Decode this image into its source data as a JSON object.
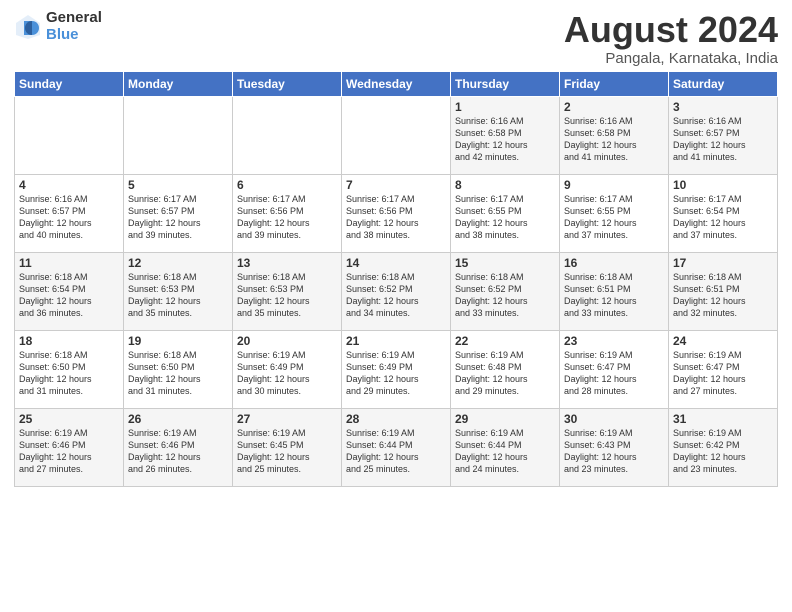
{
  "logo": {
    "general": "General",
    "blue": "Blue"
  },
  "title": {
    "month_year": "August 2024",
    "location": "Pangala, Karnataka, India"
  },
  "weekdays": [
    "Sunday",
    "Monday",
    "Tuesday",
    "Wednesday",
    "Thursday",
    "Friday",
    "Saturday"
  ],
  "weeks": [
    [
      {
        "day": "",
        "info": ""
      },
      {
        "day": "",
        "info": ""
      },
      {
        "day": "",
        "info": ""
      },
      {
        "day": "",
        "info": ""
      },
      {
        "day": "1",
        "info": "Sunrise: 6:16 AM\nSunset: 6:58 PM\nDaylight: 12 hours\nand 42 minutes."
      },
      {
        "day": "2",
        "info": "Sunrise: 6:16 AM\nSunset: 6:58 PM\nDaylight: 12 hours\nand 41 minutes."
      },
      {
        "day": "3",
        "info": "Sunrise: 6:16 AM\nSunset: 6:57 PM\nDaylight: 12 hours\nand 41 minutes."
      }
    ],
    [
      {
        "day": "4",
        "info": "Sunrise: 6:16 AM\nSunset: 6:57 PM\nDaylight: 12 hours\nand 40 minutes."
      },
      {
        "day": "5",
        "info": "Sunrise: 6:17 AM\nSunset: 6:57 PM\nDaylight: 12 hours\nand 39 minutes."
      },
      {
        "day": "6",
        "info": "Sunrise: 6:17 AM\nSunset: 6:56 PM\nDaylight: 12 hours\nand 39 minutes."
      },
      {
        "day": "7",
        "info": "Sunrise: 6:17 AM\nSunset: 6:56 PM\nDaylight: 12 hours\nand 38 minutes."
      },
      {
        "day": "8",
        "info": "Sunrise: 6:17 AM\nSunset: 6:55 PM\nDaylight: 12 hours\nand 38 minutes."
      },
      {
        "day": "9",
        "info": "Sunrise: 6:17 AM\nSunset: 6:55 PM\nDaylight: 12 hours\nand 37 minutes."
      },
      {
        "day": "10",
        "info": "Sunrise: 6:17 AM\nSunset: 6:54 PM\nDaylight: 12 hours\nand 37 minutes."
      }
    ],
    [
      {
        "day": "11",
        "info": "Sunrise: 6:18 AM\nSunset: 6:54 PM\nDaylight: 12 hours\nand 36 minutes."
      },
      {
        "day": "12",
        "info": "Sunrise: 6:18 AM\nSunset: 6:53 PM\nDaylight: 12 hours\nand 35 minutes."
      },
      {
        "day": "13",
        "info": "Sunrise: 6:18 AM\nSunset: 6:53 PM\nDaylight: 12 hours\nand 35 minutes."
      },
      {
        "day": "14",
        "info": "Sunrise: 6:18 AM\nSunset: 6:52 PM\nDaylight: 12 hours\nand 34 minutes."
      },
      {
        "day": "15",
        "info": "Sunrise: 6:18 AM\nSunset: 6:52 PM\nDaylight: 12 hours\nand 33 minutes."
      },
      {
        "day": "16",
        "info": "Sunrise: 6:18 AM\nSunset: 6:51 PM\nDaylight: 12 hours\nand 33 minutes."
      },
      {
        "day": "17",
        "info": "Sunrise: 6:18 AM\nSunset: 6:51 PM\nDaylight: 12 hours\nand 32 minutes."
      }
    ],
    [
      {
        "day": "18",
        "info": "Sunrise: 6:18 AM\nSunset: 6:50 PM\nDaylight: 12 hours\nand 31 minutes."
      },
      {
        "day": "19",
        "info": "Sunrise: 6:18 AM\nSunset: 6:50 PM\nDaylight: 12 hours\nand 31 minutes."
      },
      {
        "day": "20",
        "info": "Sunrise: 6:19 AM\nSunset: 6:49 PM\nDaylight: 12 hours\nand 30 minutes."
      },
      {
        "day": "21",
        "info": "Sunrise: 6:19 AM\nSunset: 6:49 PM\nDaylight: 12 hours\nand 29 minutes."
      },
      {
        "day": "22",
        "info": "Sunrise: 6:19 AM\nSunset: 6:48 PM\nDaylight: 12 hours\nand 29 minutes."
      },
      {
        "day": "23",
        "info": "Sunrise: 6:19 AM\nSunset: 6:47 PM\nDaylight: 12 hours\nand 28 minutes."
      },
      {
        "day": "24",
        "info": "Sunrise: 6:19 AM\nSunset: 6:47 PM\nDaylight: 12 hours\nand 27 minutes."
      }
    ],
    [
      {
        "day": "25",
        "info": "Sunrise: 6:19 AM\nSunset: 6:46 PM\nDaylight: 12 hours\nand 27 minutes."
      },
      {
        "day": "26",
        "info": "Sunrise: 6:19 AM\nSunset: 6:46 PM\nDaylight: 12 hours\nand 26 minutes."
      },
      {
        "day": "27",
        "info": "Sunrise: 6:19 AM\nSunset: 6:45 PM\nDaylight: 12 hours\nand 25 minutes."
      },
      {
        "day": "28",
        "info": "Sunrise: 6:19 AM\nSunset: 6:44 PM\nDaylight: 12 hours\nand 25 minutes."
      },
      {
        "day": "29",
        "info": "Sunrise: 6:19 AM\nSunset: 6:44 PM\nDaylight: 12 hours\nand 24 minutes."
      },
      {
        "day": "30",
        "info": "Sunrise: 6:19 AM\nSunset: 6:43 PM\nDaylight: 12 hours\nand 23 minutes."
      },
      {
        "day": "31",
        "info": "Sunrise: 6:19 AM\nSunset: 6:42 PM\nDaylight: 12 hours\nand 23 minutes."
      }
    ]
  ]
}
